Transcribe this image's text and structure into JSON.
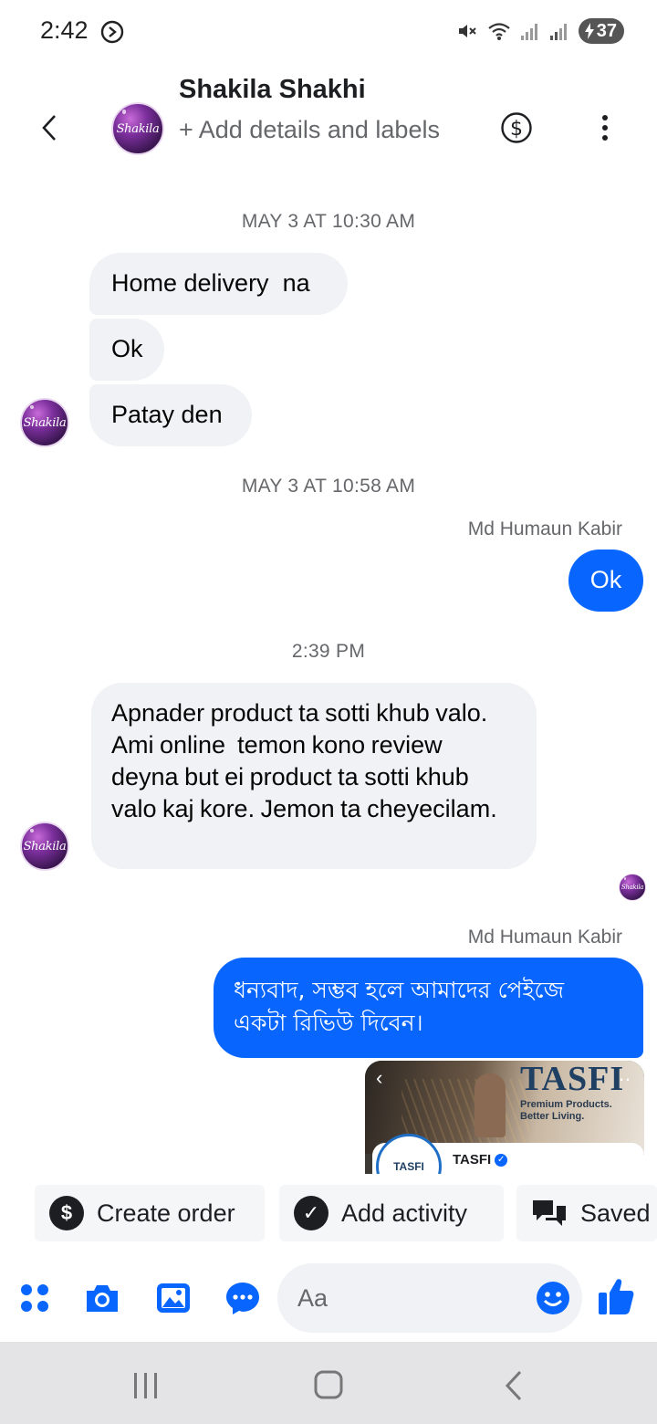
{
  "status_bar": {
    "time": "2:42",
    "battery": "37"
  },
  "header": {
    "contact_name": "Shakila Shakhi",
    "subtitle": "+ Add details and labels",
    "avatar_text": "Shakila"
  },
  "messages": {
    "ts1": "MAY 3 AT 10:30 AM",
    "m1": "Home delivery  na",
    "m2": "Ok",
    "m3": "Patay den",
    "ts2": "MAY 3 AT 10:58 AM",
    "sender1": "Md Humaun Kabir",
    "m4": "Ok",
    "ts3": "2:39 PM",
    "m5": "Apnader product ta sotti khub valo. Ami online  temon kono review  deyna but ei product ta sotti khub valo kaj kore. Jemon ta cheyecilam.",
    "sender2": "Md Humaun Kabir",
    "m6": "ধন্যবাদ, সম্ভব হলে আমাদের পেইজে একটা রিভিউ দিবেন।"
  },
  "shared_preview": {
    "brand": "TASFI",
    "tagline_1": "Premium Products.",
    "tagline_2": "Better Living.",
    "logo_text": "TASFI",
    "page_name": "TASFI"
  },
  "actions": {
    "create_order": "Create order",
    "add_activity": "Add activity",
    "saved": "Saved"
  },
  "composer": {
    "placeholder": "Aa"
  },
  "colors": {
    "accent": "#0866ff",
    "incoming_bubble": "#f0f2f5",
    "secondary_text": "#65676b"
  },
  "icons": [
    "back-arrow-icon",
    "dollar-icon",
    "more-vertical-icon",
    "apps-icon",
    "camera-icon",
    "gallery-icon",
    "chat-icon",
    "emoji-icon",
    "thumbs-up-icon",
    "recents-icon",
    "home-icon",
    "nav-back-icon"
  ]
}
